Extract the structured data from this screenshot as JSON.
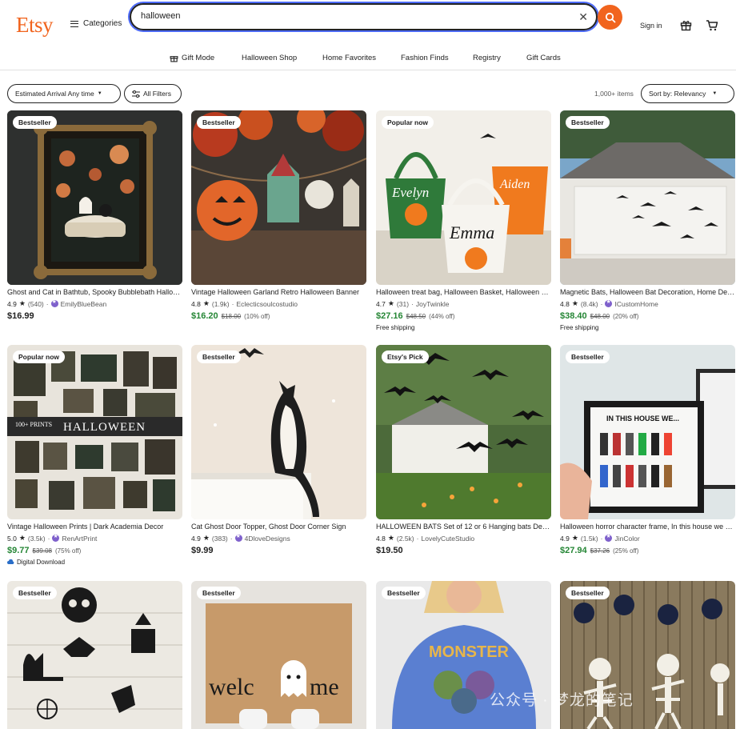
{
  "header": {
    "logo": "Etsy",
    "categories_label": "Categories",
    "search_value": "halloween",
    "signin_label": "Sign in"
  },
  "subnav": [
    "Gift Mode",
    "Halloween Shop",
    "Home Favorites",
    "Fashion Finds",
    "Registry",
    "Gift Cards"
  ],
  "filters": {
    "arrival_label": "Estimated Arrival Any time",
    "all_filters_label": "All Filters",
    "count": "1,000+ items",
    "sort_label": "Sort by: Relevancy"
  },
  "colors": {
    "brand": "#f1641e",
    "sale_price": "#258635",
    "star_seller": "#7f61cc"
  },
  "listings": [
    {
      "badge": "Bestseller",
      "title": "Ghost and Cat in Bathtub, Spooky Bubblebath Halloween Print",
      "score": "4.9",
      "reviews": "(540)",
      "shop": "EmilyBlueBean",
      "star_seller": true,
      "price": "$16.99",
      "orig": "",
      "off": "",
      "ship": "",
      "digital": ""
    },
    {
      "badge": "Bestseller",
      "title": "Vintage Halloween Garland Retro Halloween Banner",
      "score": "4.8",
      "reviews": "(1.9k)",
      "shop": "Eclecticsoulcostudio",
      "star_seller": false,
      "price": "$16.20",
      "orig": "$18.00",
      "off": "(10% off)",
      "ship": "",
      "digital": ""
    },
    {
      "badge": "Popular now",
      "title": "Halloween treat bag, Halloween Basket, Halloween Bucket",
      "score": "4.7",
      "reviews": "(31)",
      "shop": "JoyTwinkle",
      "star_seller": false,
      "price": "$27.16",
      "orig": "$48.50",
      "off": "(44% off)",
      "ship": "Free shipping",
      "digital": ""
    },
    {
      "badge": "Bestseller",
      "title": "Magnetic Bats, Halloween Bat Decoration, Home Decor",
      "score": "4.8",
      "reviews": "(8.4k)",
      "shop": "ICustomHome",
      "star_seller": true,
      "price": "$38.40",
      "orig": "$48.00",
      "off": "(20% off)",
      "ship": "Free shipping",
      "digital": ""
    },
    {
      "badge": "Popular now",
      "title": "Vintage Halloween Prints | Dark Academia Decor",
      "score": "5.0",
      "reviews": "(3.5k)",
      "shop": "RenArtPrint",
      "star_seller": true,
      "price": "$9.77",
      "orig": "$39.08",
      "off": "(75% off)",
      "ship": "",
      "digital": "Digital Download"
    },
    {
      "badge": "Bestseller",
      "title": "Cat Ghost Door Topper, Ghost Door Corner Sign",
      "score": "4.9",
      "reviews": "(383)",
      "shop": "4DloveDesigns",
      "star_seller": true,
      "price": "$9.99",
      "orig": "",
      "off": "",
      "ship": "",
      "digital": ""
    },
    {
      "badge": "Etsy's Pick",
      "title": "HALLOWEEN BATS Set of 12 or 6 Hanging bats Decoration",
      "score": "4.8",
      "reviews": "(2.5k)",
      "shop": "LovelyCuteStudio",
      "star_seller": false,
      "price": "$19.50",
      "orig": "",
      "off": "",
      "ship": "",
      "digital": ""
    },
    {
      "badge": "Bestseller",
      "title": "Halloween horror character frame, In this house we watch",
      "score": "4.9",
      "reviews": "(1.5k)",
      "shop": "JinColor",
      "star_seller": true,
      "price": "$27.94",
      "orig": "$37.26",
      "off": "(25% off)",
      "ship": "",
      "digital": ""
    },
    {
      "badge": "Bestseller"
    },
    {
      "badge": "Bestseller"
    },
    {
      "badge": "Bestseller"
    },
    {
      "badge": "Bestseller"
    }
  ],
  "images": {
    "doormat_text": "welc",
    "doormat_text2": "me",
    "frame_text": "IN THIS HOUSE WE...",
    "prints_text": "HALLOWEEN",
    "prints_count": "100+ PRINTS",
    "sweater_text": "MONSTER",
    "name1": "Evelyn",
    "name2": "Emma",
    "name3": "Aiden"
  },
  "watermark": "公众号 · 梦龙的笔记"
}
